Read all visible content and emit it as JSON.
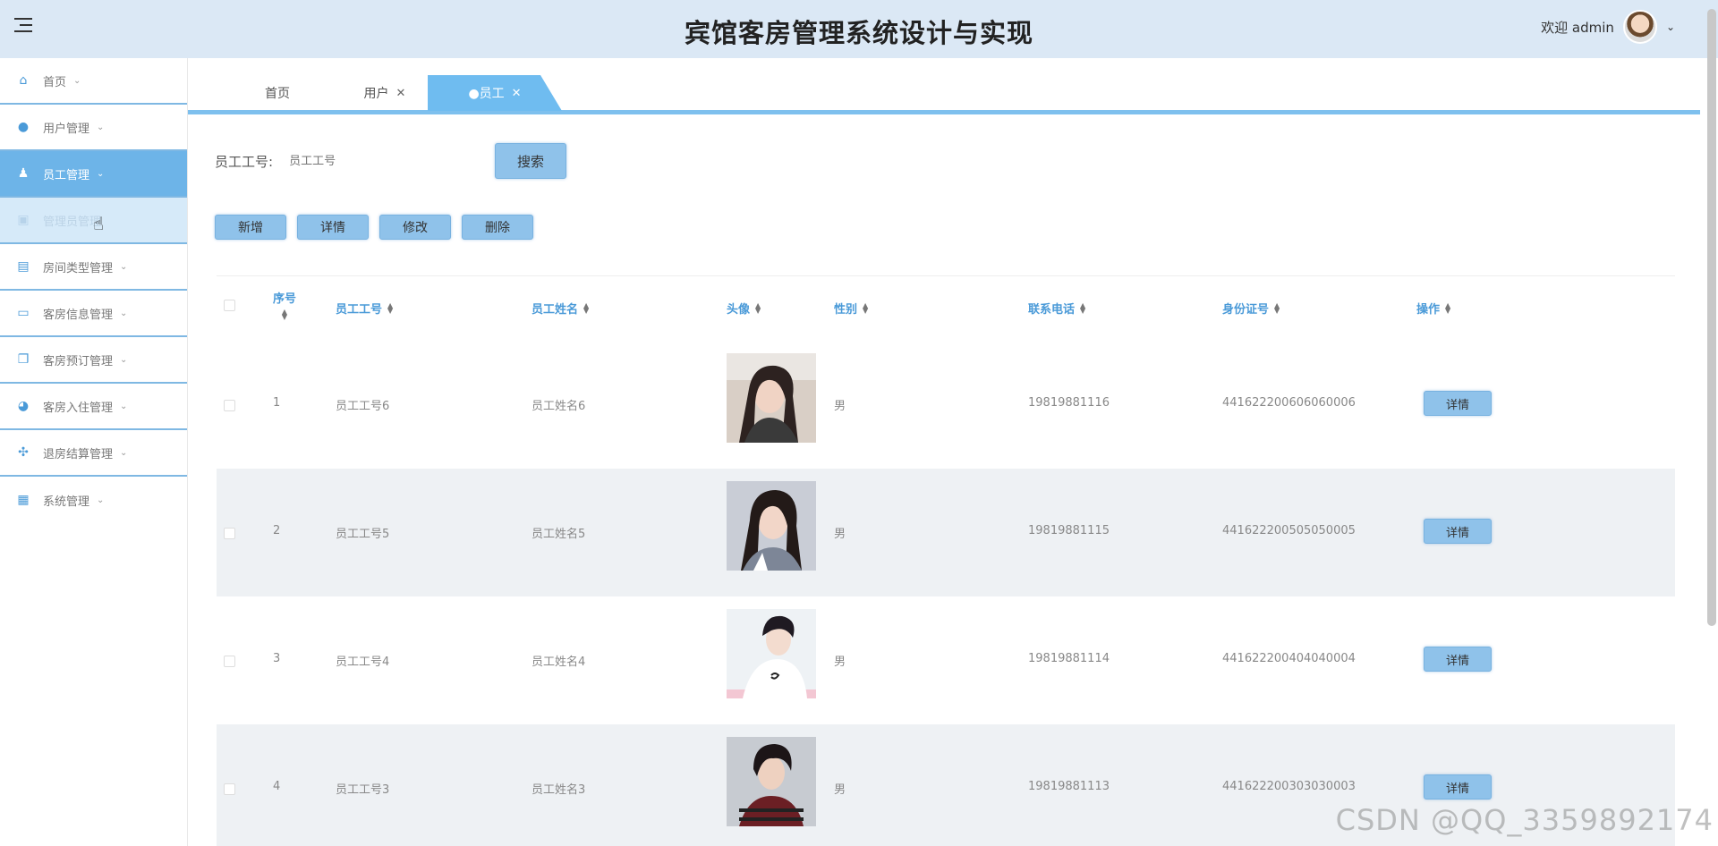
{
  "header": {
    "title": "宾馆客房管理系统设计与实现",
    "welcome": "欢迎 admin"
  },
  "sidebar": {
    "items": [
      {
        "label": "首页",
        "icon": "home-icon",
        "state": "normal"
      },
      {
        "label": "用户管理",
        "icon": "user-avatar-icon",
        "state": "normal"
      },
      {
        "label": "员工管理",
        "icon": "person-icon",
        "state": "active"
      },
      {
        "label": "管理员管理",
        "icon": "panel-icon",
        "state": "sub"
      },
      {
        "label": "房间类型管理",
        "icon": "briefcase-icon",
        "state": "normal"
      },
      {
        "label": "客房信息管理",
        "icon": "archive-icon",
        "state": "normal"
      },
      {
        "label": "客房预订管理",
        "icon": "copy-icon",
        "state": "normal"
      },
      {
        "label": "客房入住管理",
        "icon": "pie-icon",
        "state": "normal"
      },
      {
        "label": "退房结算管理",
        "icon": "apps-icon",
        "state": "normal"
      },
      {
        "label": "系统管理",
        "icon": "grid-icon",
        "state": "normal"
      }
    ]
  },
  "tabs": [
    {
      "label": "首页",
      "closable": false
    },
    {
      "label": "用户",
      "closable": true
    },
    {
      "label": "●员工",
      "closable": true,
      "active": true
    }
  ],
  "search": {
    "label": "员工工号:",
    "placeholder": "员工工号",
    "button": "搜索"
  },
  "actions": [
    "新增",
    "详情",
    "修改",
    "删除"
  ],
  "table": {
    "headers": [
      "序号",
      "员工工号",
      "员工姓名",
      "头像",
      "性别",
      "联系电话",
      "身份证号",
      "操作"
    ],
    "rows": [
      {
        "index": "1",
        "emp_no": "员工工号6",
        "name": "员工姓名6",
        "gender": "男",
        "phone": "19819881116",
        "id_no": "441622200606060006",
        "action": "详情"
      },
      {
        "index": "2",
        "emp_no": "员工工号5",
        "name": "员工姓名5",
        "gender": "男",
        "phone": "19819881115",
        "id_no": "441622200505050005",
        "action": "详情"
      },
      {
        "index": "3",
        "emp_no": "员工工号4",
        "name": "员工姓名4",
        "gender": "男",
        "phone": "19819881114",
        "id_no": "441622200404040004",
        "action": "详情"
      },
      {
        "index": "4",
        "emp_no": "员工工号3",
        "name": "员工姓名3",
        "gender": "男",
        "phone": "19819881113",
        "id_no": "441622200303030003",
        "action": "详情"
      }
    ]
  },
  "watermark": "CSDN @QQ_3359892174",
  "colors": {
    "accent": "#6db4e8",
    "header_bg": "#dbe8f5",
    "button": "#8fc2ea"
  }
}
